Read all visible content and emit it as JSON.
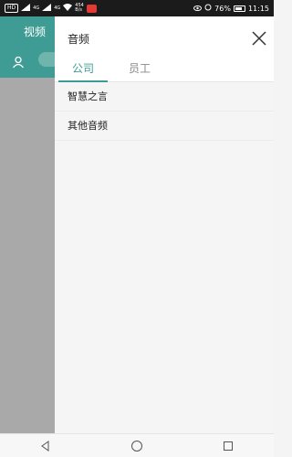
{
  "status_bar": {
    "left_chip": "HD",
    "net_a": "4G",
    "net_b": "4G",
    "speed_value": "454",
    "speed_unit": "B/s",
    "battery_percent": "76%",
    "battery_level": 0.76,
    "time": "11:15"
  },
  "background_app": {
    "title": "视频"
  },
  "drawer": {
    "title": "音频",
    "tabs": [
      {
        "label": "公司",
        "active": true
      },
      {
        "label": "员工",
        "active": false
      }
    ],
    "items": [
      {
        "label": "智慧之言"
      },
      {
        "label": "其他音频"
      }
    ]
  },
  "colors": {
    "accent": "#3e9c94",
    "overlay_gray": "#a9a9a9"
  },
  "icons": {
    "close": "close-icon",
    "user": "user-icon",
    "back": "back-triangle-icon",
    "home": "home-circle-icon",
    "recents": "recents-square-icon"
  }
}
